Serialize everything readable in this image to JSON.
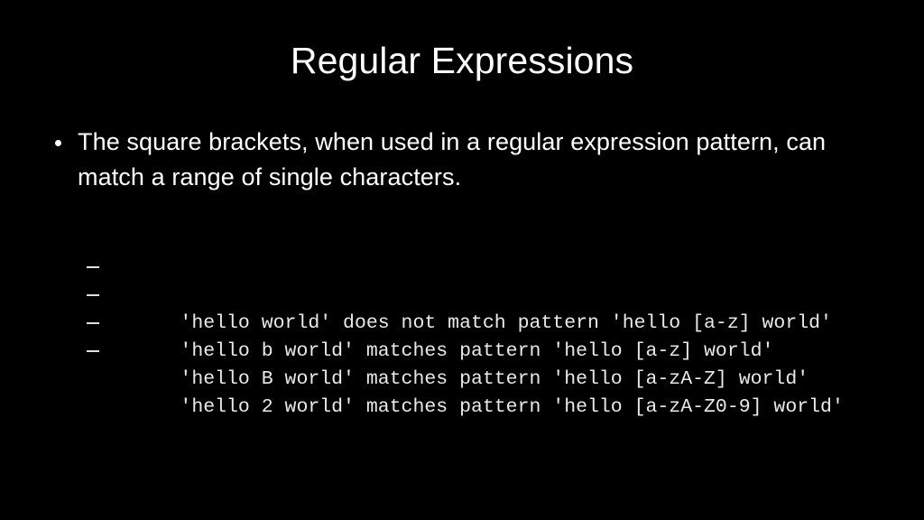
{
  "slide": {
    "title": "Regular Expressions",
    "background_color": "#000000",
    "text_color": "#ffffff",
    "code_text_color": "#e9e9e9"
  },
  "bullets": [
    {
      "marker": "bullet-dot",
      "text": "The square brackets, when used in a regular expression pattern, can match a range of single characters."
    }
  ],
  "examples": [
    {
      "marker": "dash",
      "text": "'hello world' does not match pattern 'hello [a-z] world'"
    },
    {
      "marker": "dash",
      "text": "'hello b world' matches pattern 'hello [a-z] world'"
    },
    {
      "marker": "dash",
      "text": "'hello B world' matches pattern 'hello [a-zA-Z] world'"
    },
    {
      "marker": "dash",
      "text": "'hello 2 world' matches pattern 'hello [a-zA-Z0-9] world'"
    }
  ]
}
